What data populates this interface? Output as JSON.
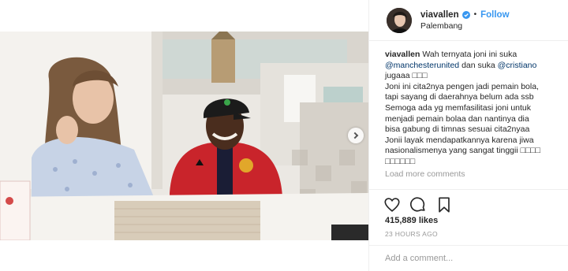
{
  "post": {
    "username": "viavallen",
    "follow_label": "Follow",
    "location": "Palembang",
    "dot": "•"
  },
  "caption": {
    "username": "viavallen",
    "line1_text": "Wah ternyata joni ini suka",
    "mention1": "@manchesterunited",
    "line2_mid": "dan suka",
    "mention2": "@cristiano",
    "line3": "jugaaa □□□",
    "line4": "Joni ini cita2nya pengen jadi pemain bola,",
    "line5": "tapi sayang di daerahnya belum ada ssb",
    "line6": "Semoga ada yg memfasilitasi joni untuk",
    "line7": "menjadi pemain bolaa dan nantinya dia",
    "line8": "bisa gabung di timnas sesuai cita2nyaa",
    "line9": "Jonii layak mendapatkannya karena jiwa",
    "line10": "nasionalismenya yang sangat tinggii □□□□",
    "line11": "□□□□□□",
    "load_more": "Load more comments"
  },
  "stats": {
    "likes": "415,889 likes",
    "time": "23 HOURS AGO"
  },
  "comment_input": {
    "placeholder": "Add a comment..."
  },
  "icons": {
    "like": "heart-icon",
    "comment": "comment-icon",
    "save": "bookmark-icon",
    "verified": "verified-badge-icon",
    "next": "chevron-right-icon"
  },
  "colors": {
    "link": "#3897f0",
    "mention": "#003569",
    "muted": "#999999",
    "border": "#efefef",
    "jacket": "#c9242b"
  }
}
